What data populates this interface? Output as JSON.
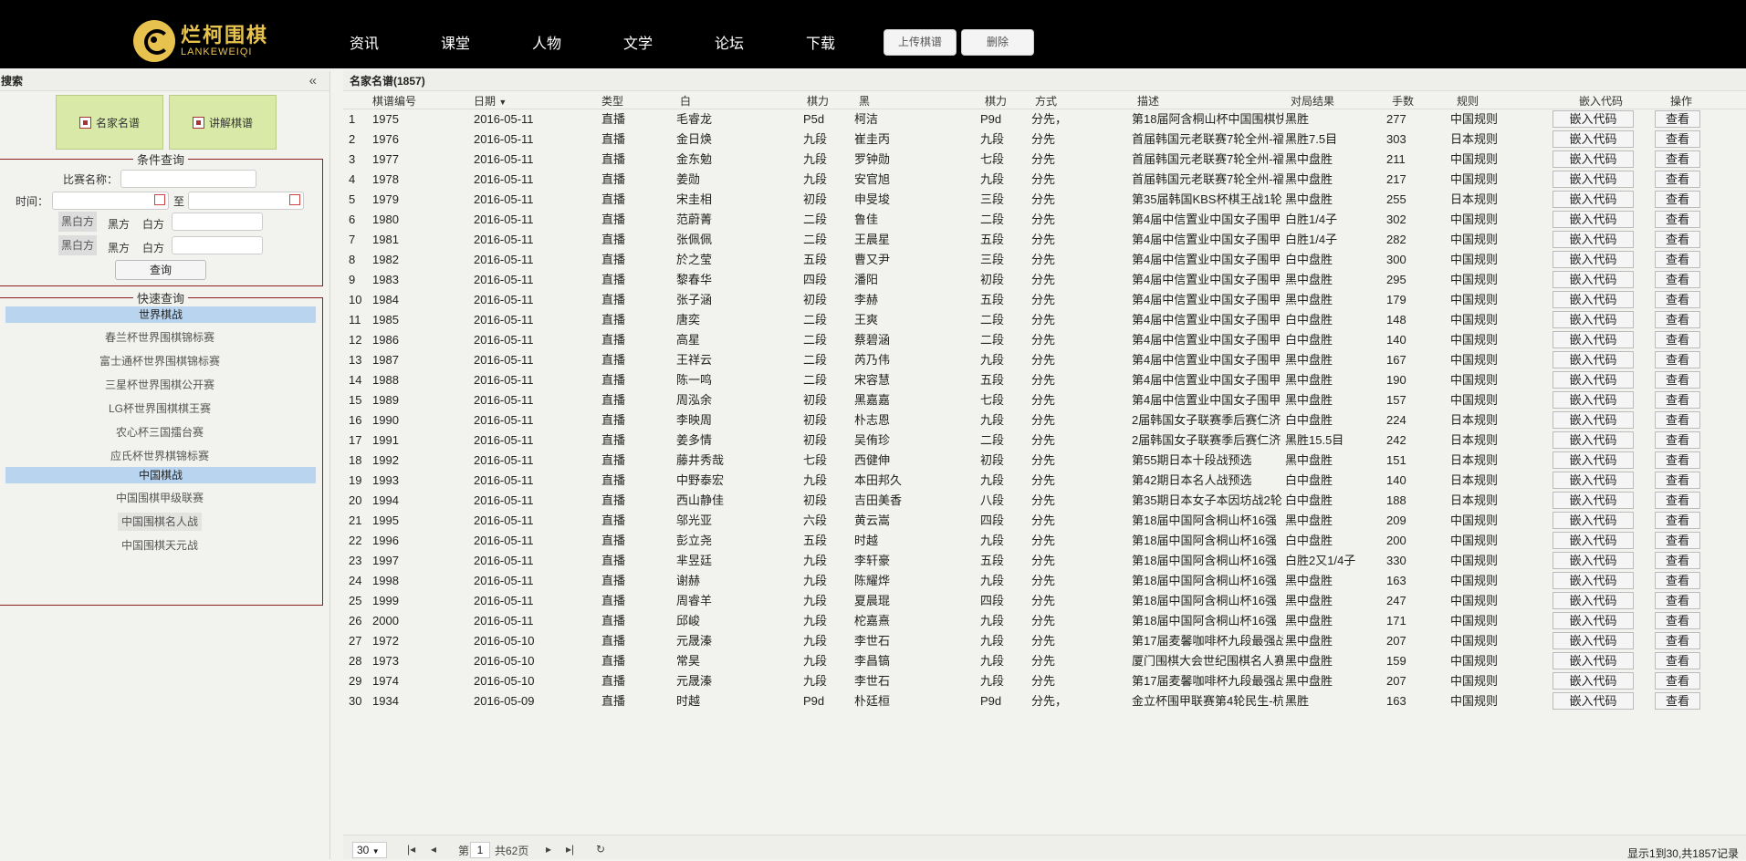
{
  "logo": {
    "cn": "烂柯围棋",
    "en": "LANKEWEIQI"
  },
  "nav": [
    "资讯",
    "课堂",
    "人物",
    "文学",
    "论坛",
    "下载"
  ],
  "top_buttons": {
    "upload": "上传棋谱",
    "delete": "删除"
  },
  "left": {
    "title": "搜索",
    "tiles": [
      "名家名谱",
      "讲解棋谱"
    ],
    "cond": {
      "legend": "条件查询",
      "match_label": "比赛名称：",
      "time_label": "时间：",
      "to": "至",
      "tag": "黑白方",
      "black": "黑方",
      "white": "白方",
      "query": "查询"
    },
    "quick": {
      "legend": "快速查询",
      "cat1": "世界棋战",
      "world": [
        "春兰杯世界围棋锦标赛",
        "富士通杯世界围棋锦标赛",
        "三星杯世界围棋公开赛",
        "LG杯世界围棋棋王赛",
        "农心杯三国擂台赛",
        "应氏杯世界棋锦标赛"
      ],
      "cat2": "中国棋战",
      "china": [
        "中国围棋甲级联赛",
        "中国围棋名人战",
        "中国围棋天元战"
      ]
    }
  },
  "grid": {
    "title": "名家名谱(1857)",
    "columns": [
      "棋谱编号",
      "日期",
      "类型",
      "白",
      "棋力",
      "黑",
      "棋力",
      "方式",
      "描述",
      "对局结果",
      "手数",
      "规则",
      "嵌入代码",
      "操作"
    ],
    "embed_label": "嵌入代码",
    "view_label": "查看",
    "rows": [
      [
        "1",
        "1975",
        "2016-05-11",
        "直播",
        "毛睿龙",
        "P5d",
        "柯洁",
        "P9d",
        "分先，",
        "第18届阿含桐山杯中国围棋快",
        "黑胜",
        "277",
        "中国规则"
      ],
      [
        "2",
        "1976",
        "2016-05-11",
        "直播",
        "金日焕",
        "九段",
        "崔圭丙",
        "九段",
        "分先",
        "首届韩国元老联赛7轮全州-福",
        "黑胜7.5目",
        "303",
        "日本规则"
      ],
      [
        "3",
        "1977",
        "2016-05-11",
        "直播",
        "金东勉",
        "九段",
        "罗钟勋",
        "七段",
        "分先",
        "首届韩国元老联赛7轮全州-福",
        "黑中盘胜",
        "211",
        "中国规则"
      ],
      [
        "4",
        "1978",
        "2016-05-11",
        "直播",
        "姜勋",
        "九段",
        "安官旭",
        "九段",
        "分先",
        "首届韩国元老联赛7轮全州-福",
        "黑中盘胜",
        "217",
        "中国规则"
      ],
      [
        "5",
        "1979",
        "2016-05-11",
        "直播",
        "宋圭相",
        "初段",
        "申旻埈",
        "三段",
        "分先",
        "第35届韩国KBS杯棋王战1轮",
        "黑中盘胜",
        "255",
        "日本规则"
      ],
      [
        "6",
        "1980",
        "2016-05-11",
        "直播",
        "范蔚菁",
        "二段",
        "鲁佳",
        "二段",
        "分先",
        "第4届中信置业中国女子围甲",
        "白胜1/4子",
        "302",
        "中国规则"
      ],
      [
        "7",
        "1981",
        "2016-05-11",
        "直播",
        "张佩佩",
        "二段",
        "王晨星",
        "五段",
        "分先",
        "第4届中信置业中国女子围甲",
        "白胜1/4子",
        "282",
        "中国规则"
      ],
      [
        "8",
        "1982",
        "2016-05-11",
        "直播",
        "於之莹",
        "五段",
        "曹又尹",
        "三段",
        "分先",
        "第4届中信置业中国女子围甲",
        "白中盘胜",
        "300",
        "中国规则"
      ],
      [
        "9",
        "1983",
        "2016-05-11",
        "直播",
        "黎春华",
        "四段",
        "潘阳",
        "初段",
        "分先",
        "第4届中信置业中国女子围甲",
        "黑中盘胜",
        "295",
        "中国规则"
      ],
      [
        "10",
        "1984",
        "2016-05-11",
        "直播",
        "张子涵",
        "初段",
        "李赫",
        "五段",
        "分先",
        "第4届中信置业中国女子围甲",
        "黑中盘胜",
        "179",
        "中国规则"
      ],
      [
        "11",
        "1985",
        "2016-05-11",
        "直播",
        "唐奕",
        "二段",
        "王爽",
        "二段",
        "分先",
        "第4届中信置业中国女子围甲",
        "白中盘胜",
        "148",
        "中国规则"
      ],
      [
        "12",
        "1986",
        "2016-05-11",
        "直播",
        "高星",
        "二段",
        "蔡碧涵",
        "二段",
        "分先",
        "第4届中信置业中国女子围甲",
        "白中盘胜",
        "140",
        "中国规则"
      ],
      [
        "13",
        "1987",
        "2016-05-11",
        "直播",
        "王祥云",
        "二段",
        "芮乃伟",
        "九段",
        "分先",
        "第4届中信置业中国女子围甲",
        "黑中盘胜",
        "167",
        "中国规则"
      ],
      [
        "14",
        "1988",
        "2016-05-11",
        "直播",
        "陈一鸣",
        "二段",
        "宋容慧",
        "五段",
        "分先",
        "第4届中信置业中国女子围甲",
        "黑中盘胜",
        "190",
        "中国规则"
      ],
      [
        "15",
        "1989",
        "2016-05-11",
        "直播",
        "周泓余",
        "初段",
        "黑嘉嘉",
        "七段",
        "分先",
        "第4届中信置业中国女子围甲",
        "黑中盘胜",
        "157",
        "中国规则"
      ],
      [
        "16",
        "1990",
        "2016-05-11",
        "直播",
        "李映周",
        "初段",
        "朴志恩",
        "九段",
        "分先",
        "2届韩国女子联赛季后赛仁济",
        "白中盘胜",
        "224",
        "日本规则"
      ],
      [
        "17",
        "1991",
        "2016-05-11",
        "直播",
        "姜多情",
        "初段",
        "吴侑珍",
        "二段",
        "分先",
        "2届韩国女子联赛季后赛仁济",
        "黑胜15.5目",
        "242",
        "日本规则"
      ],
      [
        "18",
        "1992",
        "2016-05-11",
        "直播",
        "藤井秀哉",
        "七段",
        "西健伸",
        "初段",
        "分先",
        "第55期日本十段战预选",
        "黑中盘胜",
        "151",
        "日本规则"
      ],
      [
        "19",
        "1993",
        "2016-05-11",
        "直播",
        "中野泰宏",
        "九段",
        "本田邦久",
        "九段",
        "分先",
        "第42期日本名人战预选",
        "白中盘胜",
        "140",
        "日本规则"
      ],
      [
        "20",
        "1994",
        "2016-05-11",
        "直播",
        "西山静佳",
        "初段",
        "吉田美香",
        "八段",
        "分先",
        "第35期日本女子本因坊战2轮",
        "白中盘胜",
        "188",
        "日本规则"
      ],
      [
        "21",
        "1995",
        "2016-05-11",
        "直播",
        "邬光亚",
        "六段",
        "黄云嵩",
        "四段",
        "分先",
        "第18届中国阿含桐山杯16强",
        "黑中盘胜",
        "209",
        "中国规则"
      ],
      [
        "22",
        "1996",
        "2016-05-11",
        "直播",
        "彭立尧",
        "五段",
        "时越",
        "九段",
        "分先",
        "第18届中国阿含桐山杯16强",
        "白中盘胜",
        "200",
        "中国规则"
      ],
      [
        "23",
        "1997",
        "2016-05-11",
        "直播",
        "芈昱廷",
        "九段",
        "李轩豪",
        "五段",
        "分先",
        "第18届中国阿含桐山杯16强",
        "白胜2又1/4子",
        "330",
        "中国规则"
      ],
      [
        "24",
        "1998",
        "2016-05-11",
        "直播",
        "谢赫",
        "九段",
        "陈耀烨",
        "九段",
        "分先",
        "第18届中国阿含桐山杯16强",
        "黑中盘胜",
        "163",
        "中国规则"
      ],
      [
        "25",
        "1999",
        "2016-05-11",
        "直播",
        "周睿羊",
        "九段",
        "夏晨琨",
        "四段",
        "分先",
        "第18届中国阿含桐山杯16强",
        "黑中盘胜",
        "247",
        "中国规则"
      ],
      [
        "26",
        "2000",
        "2016-05-11",
        "直播",
        "邱峻",
        "九段",
        "柁嘉熹",
        "九段",
        "分先",
        "第18届中国阿含桐山杯16强",
        "黑中盘胜",
        "171",
        "中国规则"
      ],
      [
        "27",
        "1972",
        "2016-05-10",
        "直播",
        "元晟溱",
        "九段",
        "李世石",
        "九段",
        "分先",
        "第17届麦馨咖啡杯九段最强战",
        "黑中盘胜",
        "207",
        "中国规则"
      ],
      [
        "28",
        "1973",
        "2016-05-10",
        "直播",
        "常昊",
        "九段",
        "李昌镐",
        "九段",
        "分先",
        "厦门围棋大会世纪围棋名人赛",
        "黑中盘胜",
        "159",
        "中国规则"
      ],
      [
        "29",
        "1974",
        "2016-05-10",
        "直播",
        "元晟溱",
        "九段",
        "李世石",
        "九段",
        "分先",
        "第17届麦馨咖啡杯九段最强战",
        "黑中盘胜",
        "207",
        "中国规则"
      ],
      [
        "30",
        "1934",
        "2016-05-09",
        "直播",
        "时越",
        "P9d",
        "朴廷桓",
        "P9d",
        "分先，",
        "金立杯围甲联赛第4轮民生-杭",
        "黑胜",
        "163",
        "中国规则"
      ]
    ]
  },
  "pager": {
    "page_size": "30",
    "page_label": "第",
    "page": "1",
    "pages": "共62页",
    "summary": "显示1到30,共1857记录"
  }
}
